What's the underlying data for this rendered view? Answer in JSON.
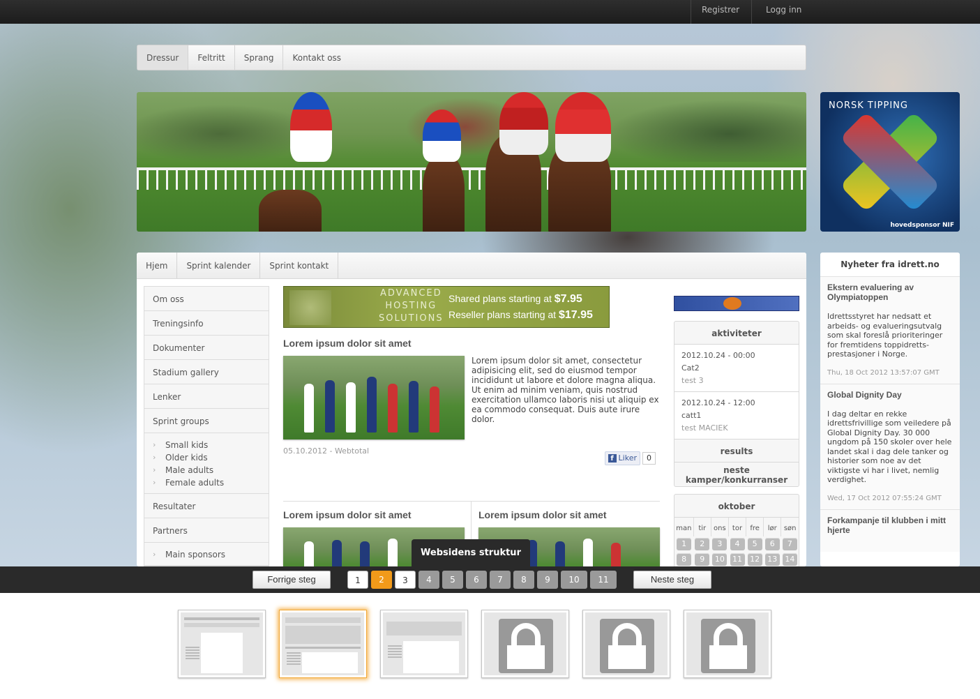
{
  "topbar": {
    "register": "Registrer",
    "login": "Logg inn"
  },
  "main_nav": [
    "Dressur",
    "Feltritt",
    "Sprang",
    "Kontakt oss"
  ],
  "sponsor": {
    "title": "NORSK  TIPPING",
    "subtitle": "hovedsponsor NIF"
  },
  "sub_nav": [
    "Hjem",
    "Sprint kalender",
    "Sprint kontakt"
  ],
  "left_menu": {
    "items_top": [
      "Om oss",
      "Treningsinfo",
      "Dokumenter",
      "Stadium gallery",
      "Lenker",
      "Sprint groups"
    ],
    "sprint_groups": [
      "Small kids",
      "Older kids",
      "Male adults",
      "Female adults"
    ],
    "items_bottom": [
      "Resultater",
      "Partners"
    ],
    "sub_bottom": [
      "Main sponsors"
    ]
  },
  "ad": {
    "left_lines": [
      "ADVANCED",
      "HOSTING",
      "SOLUTIONS"
    ],
    "line1_prefix": "Shared plans starting at ",
    "line1_price": "$7.95",
    "line2_prefix": "Reseller plans starting at ",
    "line2_price": "$17.95"
  },
  "article_main": {
    "title": "Lorem ipsum dolor sit amet",
    "body": "Lorem ipsum dolor sit amet, consectetur adipisicing elit, sed do eiusmod tempor incididunt ut labore et dolore magna aliqua. Ut enim ad minim veniam, quis nostrud exercitation ullamco laboris nisi ut aliquip ex ea commodo consequat. Duis aute irure dolor.",
    "meta": "05.10.2012 - Webtotal",
    "like_label": "Liker",
    "like_count": "0"
  },
  "article_2": {
    "title": "Lorem ipsum dolor sit amet"
  },
  "article_3": {
    "title": "Lorem ipsum dolor sit amet"
  },
  "activities": {
    "title": "aktiviteter",
    "events": [
      {
        "date": "2012.10.24 - 00:00",
        "name": "Cat2",
        "desc": "test 3"
      },
      {
        "date": "2012.10.24 - 12:00",
        "name": "catt1",
        "desc": "test MACIEK"
      }
    ],
    "results": "results",
    "next": "neste kamper/konkurranser"
  },
  "calendar": {
    "month": "oktober",
    "weekdays": [
      "man",
      "tir",
      "ons",
      "tor",
      "fre",
      "lør",
      "søn"
    ],
    "week1": [
      "1",
      "2",
      "3",
      "4",
      "5",
      "6",
      "7"
    ],
    "week2": [
      "8",
      "9",
      "10",
      "11",
      "12",
      "13",
      "14"
    ]
  },
  "news": {
    "title": "Nyheter fra idrett.no",
    "items": [
      {
        "title": "Ekstern evaluering av Olympiatoppen",
        "body": "Idrettsstyret har nedsatt et arbeids- og evalueringsutvalg som skal foreslå prioriteringer for fremtidens toppidretts-prestasjoner i Norge.",
        "date": "Thu, 18 Oct 2012 13:57:07 GMT"
      },
      {
        "title": "Global Dignity Day",
        "body": "I dag deltar en rekke idrettsfrivillige som veiledere på Global Dignity Day. 30 000 ungdom på 150 skoler over hele landet skal i dag dele tanker og historier som noe av det viktigste vi har i livet, nemlig verdighet.",
        "date": "Wed, 17 Oct 2012 07:55:24 GMT"
      },
      {
        "title": "Forkampanje til klubben i mitt hjerte",
        "body": "",
        "date": ""
      }
    ]
  },
  "wizard": {
    "tooltip": "Websidens struktur",
    "prev": "Forrige steg",
    "next": "Neste steg",
    "pages": [
      "1",
      "2",
      "3",
      "4",
      "5",
      "6",
      "7",
      "8",
      "9",
      "10",
      "11"
    ],
    "current_page": "2"
  },
  "colors": {
    "accent": "#f29a1a",
    "bar": "#2a2a2a"
  }
}
